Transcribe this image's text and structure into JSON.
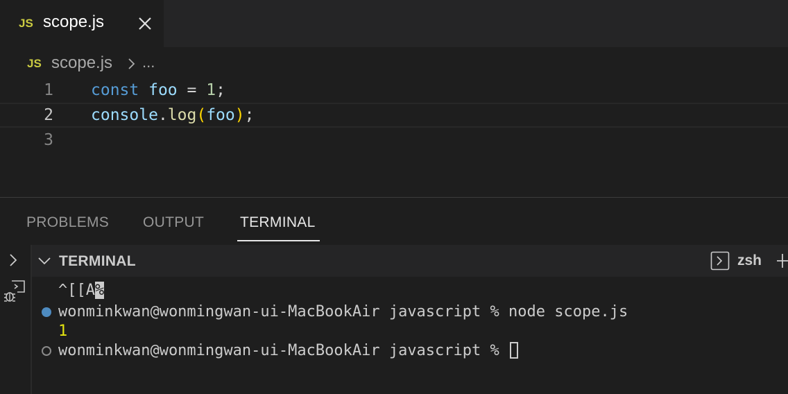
{
  "tab": {
    "badge": "JS",
    "title": "scope.js"
  },
  "breadcrumb": {
    "badge": "JS",
    "file": "scope.js",
    "more": "..."
  },
  "editor": {
    "lines": [
      {
        "number": "1",
        "tokens": [
          "const",
          "foo",
          "=",
          "1",
          ";"
        ]
      },
      {
        "number": "2",
        "tokens": [
          "console",
          ".",
          "log",
          "(",
          "foo",
          ")",
          ";"
        ]
      },
      {
        "number": "3",
        "tokens": []
      }
    ],
    "current_line": 2
  },
  "panel": {
    "tabs": [
      "PROBLEMS",
      "OUTPUT",
      "TERMINAL"
    ],
    "active_tab": "TERMINAL",
    "terminal_title": "TERMINAL",
    "shell": "zsh"
  },
  "terminal": {
    "line1_prefix": "^[[A",
    "line1_cursor_char": "%",
    "command_prompt": "wonminkwan@wonmingwan-ui-MacBookAir javascript % node scope.js",
    "output": "1",
    "idle_prompt": "wonminkwan@wonmingwan-ui-MacBookAir javascript % "
  },
  "colors": {
    "js_badge": "#cbcb41",
    "keyword": "#569cd6",
    "variable": "#9cdcfe",
    "number": "#b5cea8",
    "function": "#dcdcaa",
    "bracket": "#ffd700",
    "success_dot": "#4e8bc0",
    "output_yellow": "#e5e510"
  },
  "icons": [
    "close-icon",
    "chevron-right-icon",
    "chevron-down-icon",
    "debug-console-icon",
    "terminal-shell-icon",
    "plus-icon"
  ]
}
